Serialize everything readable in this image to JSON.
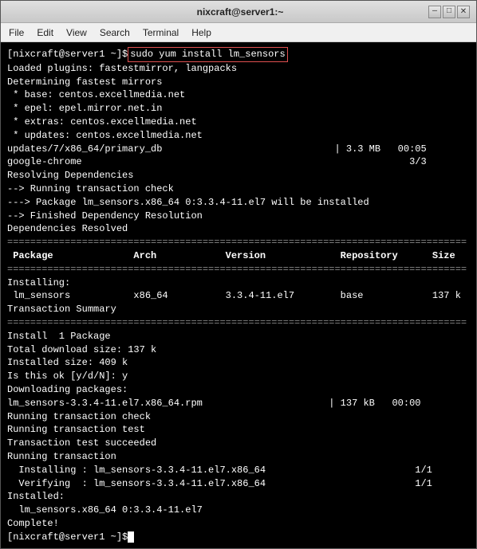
{
  "window": {
    "title": "nixcraft@server1:~",
    "min_label": "—",
    "max_label": "□",
    "close_label": "✕"
  },
  "menubar": {
    "items": [
      "File",
      "Edit",
      "View",
      "Search",
      "Terminal",
      "Help"
    ]
  },
  "terminal": {
    "prompt1": "[nixcraft@server1 ~]$ ",
    "command": "sudo yum install lm_sensors",
    "output": [
      "Loaded plugins: fastestmirror, langpacks",
      "Determining fastest mirrors",
      " * base: centos.excellmedia.net",
      " * epel: epel.mirror.net.in",
      " * extras: centos.excellmedia.net",
      " * updates: centos.excellmedia.net",
      "updates/7/x86_64/primary_db                              | 3.3 MB   00:05",
      "google-chrome                                                         3/3",
      "Resolving Dependencies",
      "--> Running transaction check",
      "---> Package lm_sensors.x86_64 0:3.3.4-11.el7 will be installed",
      "--> Finished Dependency Resolution",
      "",
      "Dependencies Resolved",
      ""
    ],
    "separator1": "================================================================================",
    "table_header": " Package              Arch            Version             Repository      Size",
    "separator2": "================================================================================",
    "section_installing": "Installing:",
    "table_row": " lm_sensors           x86_64          3.3.4-11.el7        base            137 k",
    "blank1": "",
    "transaction_summary": "Transaction Summary",
    "separator3": "================================================================================",
    "install_line": "Install  1 Package",
    "blank2": "",
    "output2": [
      "Total download size: 137 k",
      "Installed size: 409 k",
      "Is this ok [y/d/N]: y",
      "Downloading packages:",
      "lm_sensors-3.3.4-11.el7.x86_64.rpm                      | 137 kB   00:00",
      "Running transaction check",
      "Running transaction test",
      "Transaction test succeeded",
      "Running transaction",
      "  Installing : lm_sensors-3.3.4-11.el7.x86_64                          1/1",
      "  Verifying  : lm_sensors-3.3.4-11.el7.x86_64                          1/1",
      "",
      "Installed:",
      "  lm_sensors.x86_64 0:3.3.4-11.el7",
      "",
      "Complete!"
    ],
    "prompt2": "[nixcraft@server1 ~]$ "
  }
}
